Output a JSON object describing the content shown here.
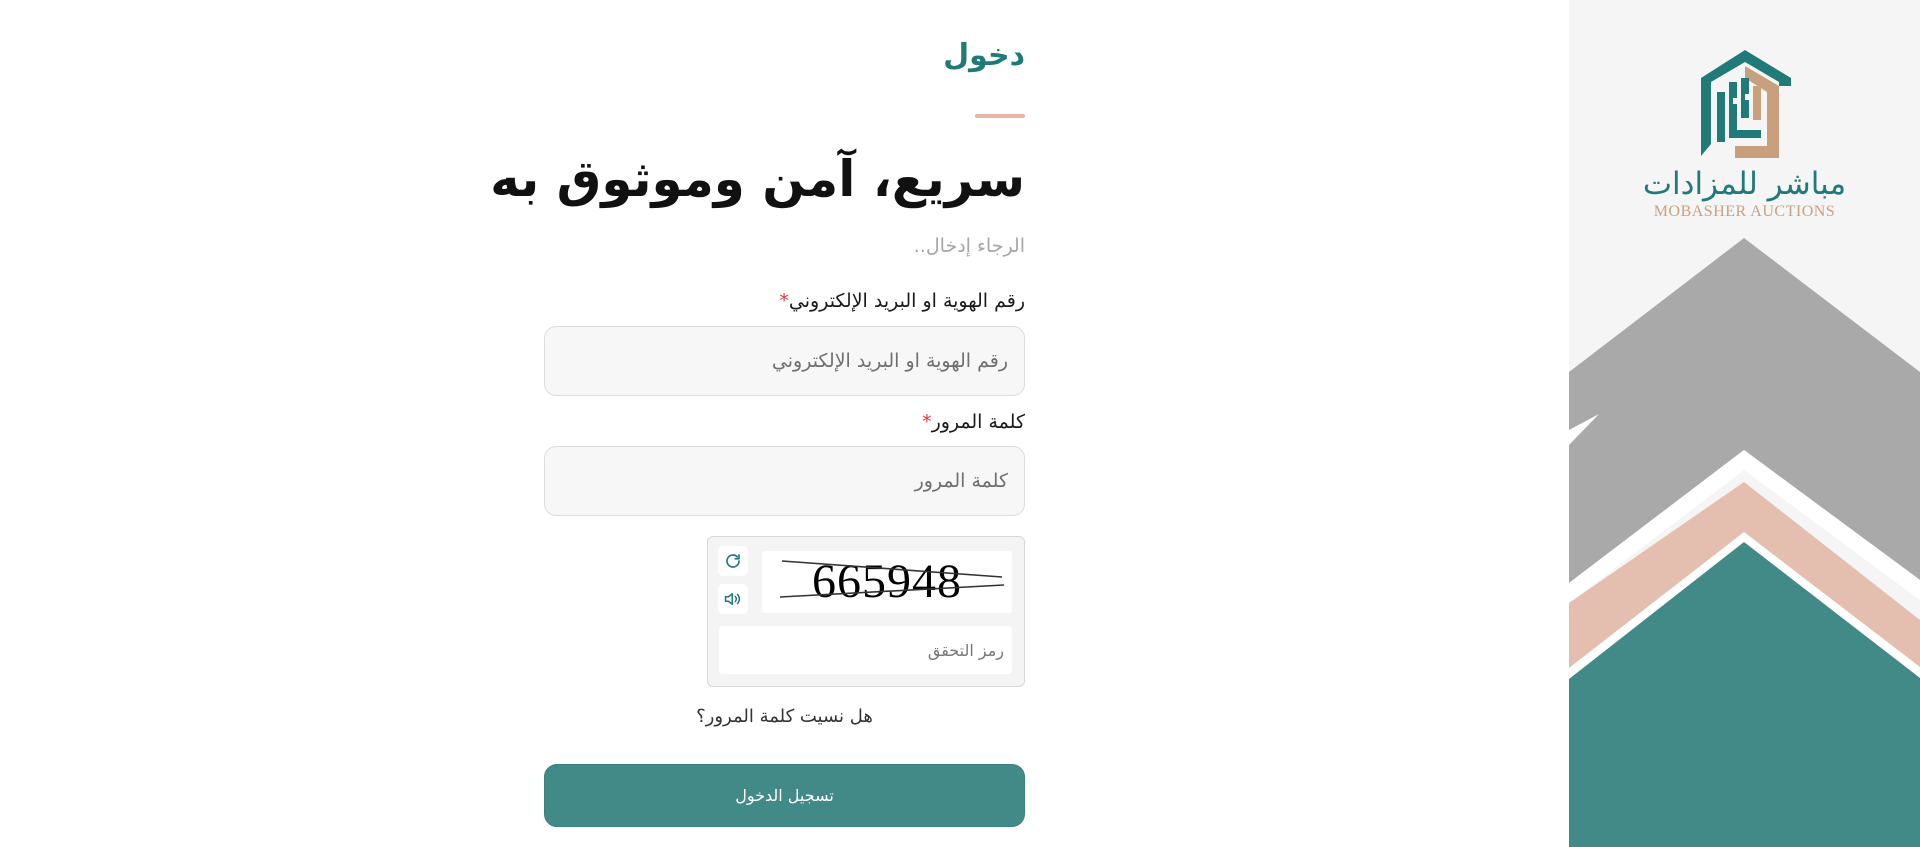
{
  "header": {
    "tab_title": "دخول",
    "headline": "سريع، آمن وموثوق به",
    "subtitle": "الرجاء إدخال.."
  },
  "form": {
    "identity": {
      "label": "رقم الهوية او البريد الإلكتروني",
      "required_mark": "*",
      "placeholder": "رقم الهوية او البريد الإلكتروني",
      "value": ""
    },
    "password": {
      "label": "كلمة المرور",
      "required_mark": "*",
      "placeholder": "كلمة المرور",
      "value": ""
    },
    "captcha": {
      "code": "665948",
      "placeholder": "رمز التحقق",
      "value": "",
      "refresh_icon": "refresh-icon",
      "audio_icon": "speaker-icon"
    },
    "forgot_password": "هل نسيت كلمة المرور؟",
    "submit_label": "تسجيل الدخول"
  },
  "brand": {
    "name_ar": "مباشر للمزادات",
    "name_en": "MOBASHER AUCTIONS"
  },
  "colors": {
    "primary": "#428a88",
    "brand_teal": "#1f7a78",
    "accent_peach": "#e3b7a6",
    "brand_gold": "#c9a07e",
    "panel_gray": "#a6a6a6",
    "required_red": "#e0353b"
  }
}
